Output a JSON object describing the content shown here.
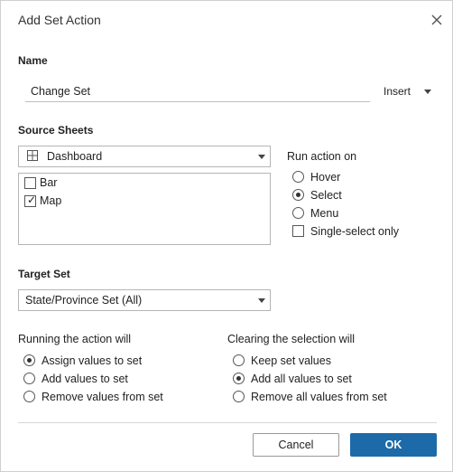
{
  "dialog": {
    "title": "Add Set Action",
    "close_icon": "close-icon"
  },
  "name": {
    "label": "Name",
    "value": "Change Set",
    "insert_label": "Insert"
  },
  "source_sheets": {
    "label": "Source Sheets",
    "selected": "Dashboard",
    "sheets": [
      {
        "label": "Bar",
        "checked": false
      },
      {
        "label": "Map",
        "checked": true
      }
    ]
  },
  "run_action_on": {
    "label": "Run action on",
    "options": [
      {
        "label": "Hover",
        "selected": false
      },
      {
        "label": "Select",
        "selected": true
      },
      {
        "label": "Menu",
        "selected": false
      }
    ],
    "single_select_label": "Single-select only",
    "single_select_checked": false
  },
  "target_set": {
    "label": "Target Set",
    "selected": "State/Province Set (All)"
  },
  "running_action": {
    "label": "Running the action will",
    "options": [
      {
        "label": "Assign values to set",
        "selected": true
      },
      {
        "label": "Add values to set",
        "selected": false
      },
      {
        "label": "Remove values from set",
        "selected": false
      }
    ]
  },
  "clearing_selection": {
    "label": "Clearing the selection will",
    "options": [
      {
        "label": "Keep set values",
        "selected": false
      },
      {
        "label": "Add all values to set",
        "selected": true
      },
      {
        "label": "Remove all values from set",
        "selected": false
      }
    ]
  },
  "buttons": {
    "cancel": "Cancel",
    "ok": "OK"
  },
  "colors": {
    "ok_button": "#1c6aa8"
  }
}
